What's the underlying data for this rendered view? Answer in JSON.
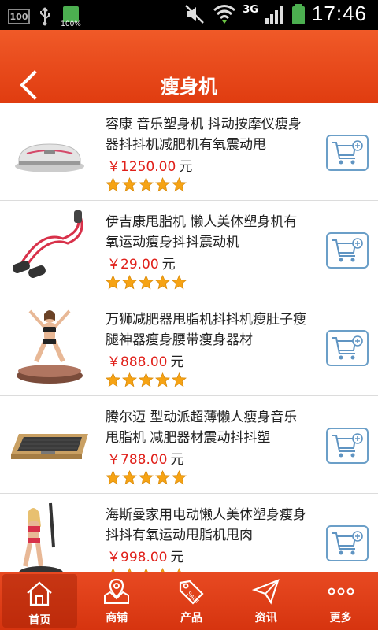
{
  "statusbar": {
    "box_label": "100",
    "battery_small_label": "100%",
    "network": "3G",
    "time": "17:46"
  },
  "header": {
    "title": "瘦身机"
  },
  "products": [
    {
      "name": "容康 音乐塑身机 抖动按摩仪瘦身器抖抖机减肥机有氧震动甩",
      "price": "￥1250.00",
      "unit": "元",
      "rating": 5
    },
    {
      "name": "伊吉康甩脂机 懒人美体塑身机有氧运动瘦身抖抖震动机",
      "price": "￥29.00",
      "unit": "元",
      "rating": 5
    },
    {
      "name": "万狮减肥器甩脂机抖抖机瘦肚子瘦腿神器瘦身腰带瘦身器材",
      "price": "￥888.00",
      "unit": "元",
      "rating": 5
    },
    {
      "name": "腾尔迈 型动派超薄懒人瘦身音乐甩脂机 减肥器材震动抖抖塑",
      "price": "￥788.00",
      "unit": "元",
      "rating": 5
    },
    {
      "name": "海斯曼家用电动懒人美体塑身瘦身抖抖有氧运动甩脂机甩肉",
      "price": "￥998.00",
      "unit": "元",
      "rating": 5
    }
  ],
  "nav": [
    {
      "label": "首页",
      "icon": "home-icon",
      "active": true
    },
    {
      "label": "商铺",
      "icon": "map-icon"
    },
    {
      "label": "产品",
      "icon": "tag-icon"
    },
    {
      "label": "资讯",
      "icon": "send-icon"
    },
    {
      "label": "更多",
      "icon": "more-icon"
    }
  ]
}
